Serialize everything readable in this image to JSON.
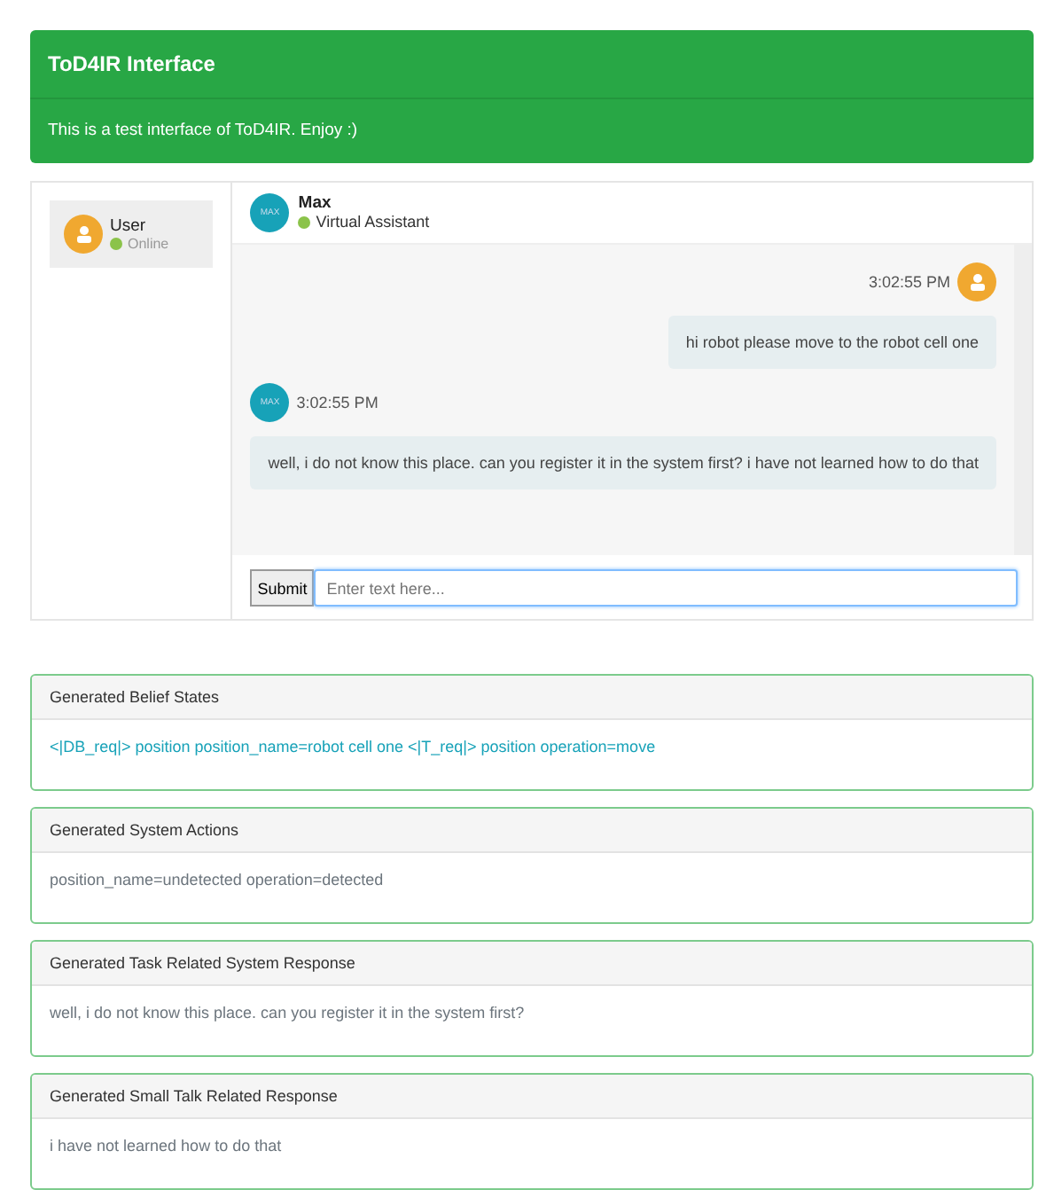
{
  "header": {
    "title": "ToD4IR Interface",
    "subtitle": "This is a test interface of ToD4IR. Enjoy :)"
  },
  "user": {
    "name": "User",
    "status": "Online",
    "online": true
  },
  "assistant": {
    "avatar": "MAX",
    "name": "Max",
    "role": "Virtual Assistant",
    "online": true
  },
  "messages": [
    {
      "kind": "user",
      "time": "3:02:55 PM",
      "text": "hi robot please move to the robot cell one"
    },
    {
      "kind": "bot",
      "avatar": "MAX",
      "time": "3:02:55 PM",
      "text": "well, i do not know this place. can you register it in the system first? i have not learned how to do that"
    }
  ],
  "composer": {
    "button": "Submit",
    "placeholder": "Enter text here..."
  },
  "cards": [
    {
      "title": "Generated Belief States",
      "kind": "info",
      "body": "<|DB_req|> position position_name=robot cell one <|T_req|> position operation=move"
    },
    {
      "title": "Generated System Actions",
      "kind": "muted",
      "body": "position_name=undetected operation=detected"
    },
    {
      "title": "Generated Task Related System Response",
      "kind": "muted",
      "body": "well, i do not know this place. can you register it in the system first?"
    },
    {
      "title": "Generated Small Talk Related Response",
      "kind": "muted",
      "body": "i have not learned how to do that"
    }
  ]
}
